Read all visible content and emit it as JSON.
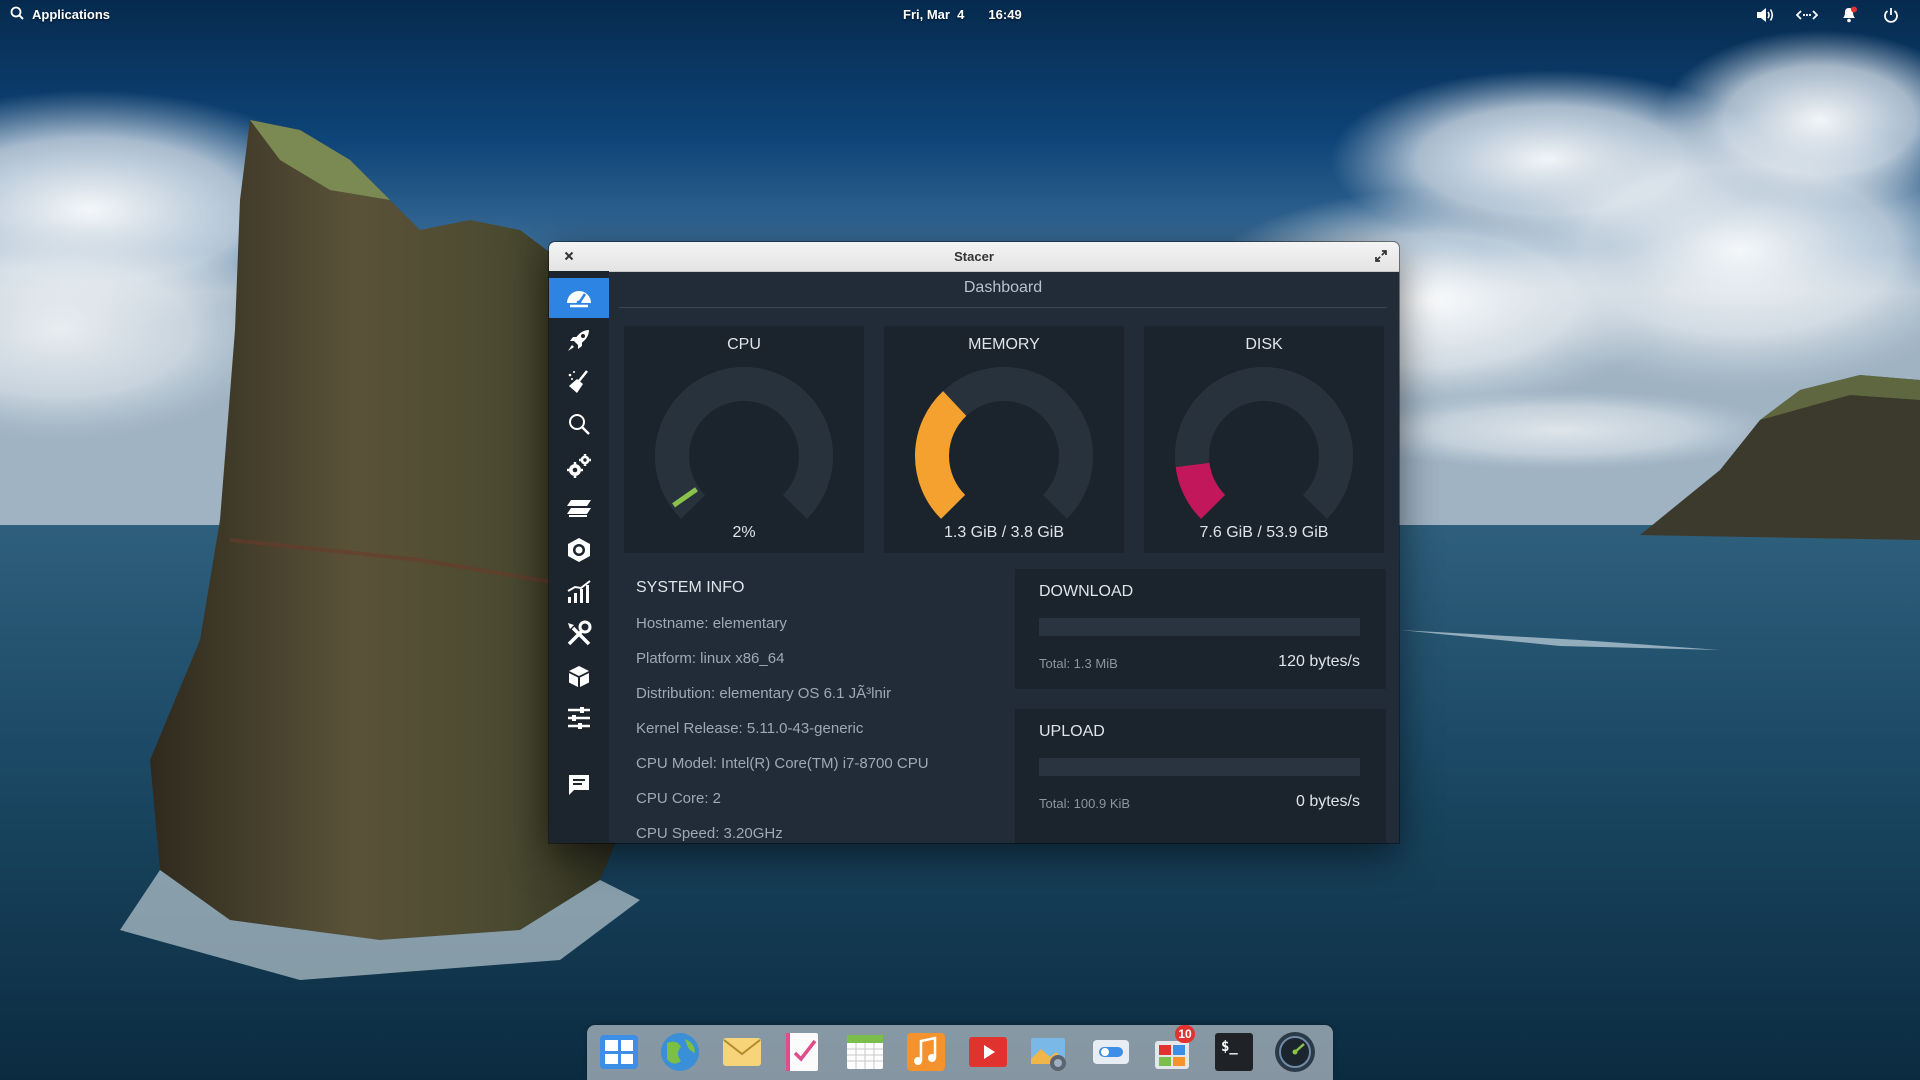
{
  "top_panel": {
    "applications_label": "Applications",
    "date": "Fri, Mar  4",
    "time": "16:49",
    "indicators": [
      "volume-icon",
      "network-icon",
      "notifications-icon",
      "power-icon"
    ]
  },
  "window": {
    "title": "Stacer",
    "page_title": "Dashboard",
    "accent_color": "#2d84e3",
    "sidebar": [
      {
        "icon": "dashboard-gauge-icon",
        "active": true
      },
      {
        "icon": "rocket-icon"
      },
      {
        "icon": "broom-cleaner-icon"
      },
      {
        "icon": "search-icon"
      },
      {
        "icon": "gears-services-icon"
      },
      {
        "icon": "processes-layers-icon"
      },
      {
        "icon": "uninstaller-package-icon"
      },
      {
        "icon": "resources-chart-icon"
      },
      {
        "icon": "tools-icon"
      },
      {
        "icon": "apt-repository-box-icon"
      },
      {
        "icon": "settings-sliders-icon"
      },
      {
        "icon": "feedback-message-icon"
      }
    ],
    "gauges": {
      "cpu": {
        "title": "CPU",
        "value": "2%",
        "fraction": 0.02,
        "color": "#8bc34a"
      },
      "memory": {
        "title": "MEMORY",
        "value": "1.3 GiB / 3.8 GiB",
        "fraction": 0.34,
        "color": "#f5a12f"
      },
      "disk": {
        "title": "DISK",
        "value": "7.6 GiB / 53.9 GiB",
        "fraction": 0.14,
        "color": "#c2185b"
      }
    },
    "system_info": {
      "heading": "SYSTEM INFO",
      "hostname": "Hostname: elementary",
      "platform": "Platform: linux x86_64",
      "distribution": "Distribution: elementary OS 6.1 JÃ³lnir",
      "kernel": "Kernel Release: 5.11.0-43-generic",
      "cpu_model": "CPU Model: Intel(R) Core(TM) i7-8700 CPU",
      "cpu_core": "CPU Core: 2",
      "cpu_speed": "CPU Speed: 3.20GHz"
    },
    "download": {
      "title": "DOWNLOAD",
      "total": "Total: 1.3 MiB",
      "rate": "120 bytes/s",
      "fraction": 0.0
    },
    "upload": {
      "title": "UPLOAD",
      "total": "Total: 100.9 KiB",
      "rate": "0 bytes/s",
      "fraction": 0.0
    }
  },
  "dock": {
    "items": [
      {
        "icon": "multitasking-view-icon"
      },
      {
        "icon": "web-browser-icon"
      },
      {
        "icon": "mail-icon"
      },
      {
        "icon": "tasks-icon"
      },
      {
        "icon": "calendar-icon"
      },
      {
        "icon": "music-icon"
      },
      {
        "icon": "videos-icon"
      },
      {
        "icon": "photos-icon"
      },
      {
        "icon": "system-settings-icon"
      },
      {
        "icon": "appcenter-icon",
        "badge": "10"
      },
      {
        "icon": "terminal-icon"
      },
      {
        "icon": "stacer-icon"
      }
    ],
    "terminal_prompt": "$_"
  }
}
